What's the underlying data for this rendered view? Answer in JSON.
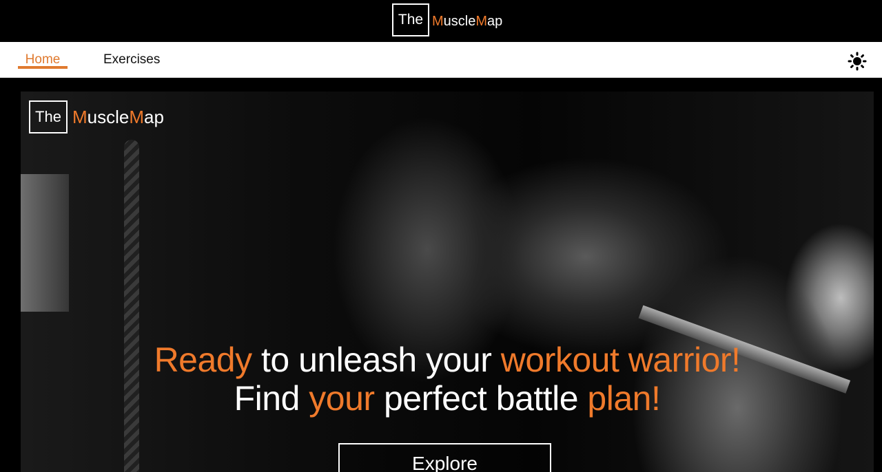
{
  "brand": {
    "prefix": "The",
    "name_first_letter": "M",
    "name_part1": "uscle",
    "name_second_letter": "M",
    "name_part2": "ap"
  },
  "nav": {
    "items": [
      {
        "label": "Home",
        "active": true
      },
      {
        "label": "Exercises",
        "active": false
      }
    ],
    "theme_toggle_icon": "sun-icon"
  },
  "hero": {
    "line1": [
      "Ready",
      " to unleash your ",
      "workout warrior!"
    ],
    "line2": [
      "Find ",
      "your",
      " perfect battle ",
      "plan!"
    ],
    "cta_label": "Explore"
  },
  "colors": {
    "accent": "#f07a2b",
    "nav_background": "#ffffff",
    "page_background": "#000000"
  }
}
